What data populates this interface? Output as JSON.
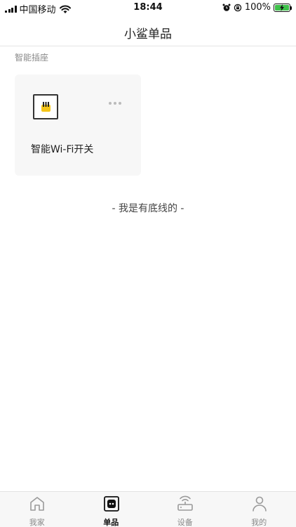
{
  "status_bar": {
    "carrier": "中国移动",
    "time": "18:44",
    "battery": "100%",
    "battery_level": 1.0,
    "icons": [
      "signal-icon",
      "wifi-icon",
      "alarm-icon",
      "rotation-lock-icon",
      "battery-icon"
    ]
  },
  "nav": {
    "title": "小鲨单品"
  },
  "section": {
    "title": "智能插座"
  },
  "devices": [
    {
      "name": "智能Wi-Fi开关",
      "icon": "smart-switch-icon",
      "icon_accent": "#f5c518"
    }
  ],
  "footer_text": "- 我是有底线的 -",
  "tabs": [
    {
      "label": "我家",
      "icon": "home-icon",
      "active": false
    },
    {
      "label": "单品",
      "icon": "single-product-icon",
      "active": true
    },
    {
      "label": "设备",
      "icon": "router-icon",
      "active": false
    },
    {
      "label": "我的",
      "icon": "person-icon",
      "active": false
    }
  ],
  "colors": {
    "battery": "#3ec14a",
    "tab_active": "#111111",
    "tab_inactive": "#888888"
  }
}
